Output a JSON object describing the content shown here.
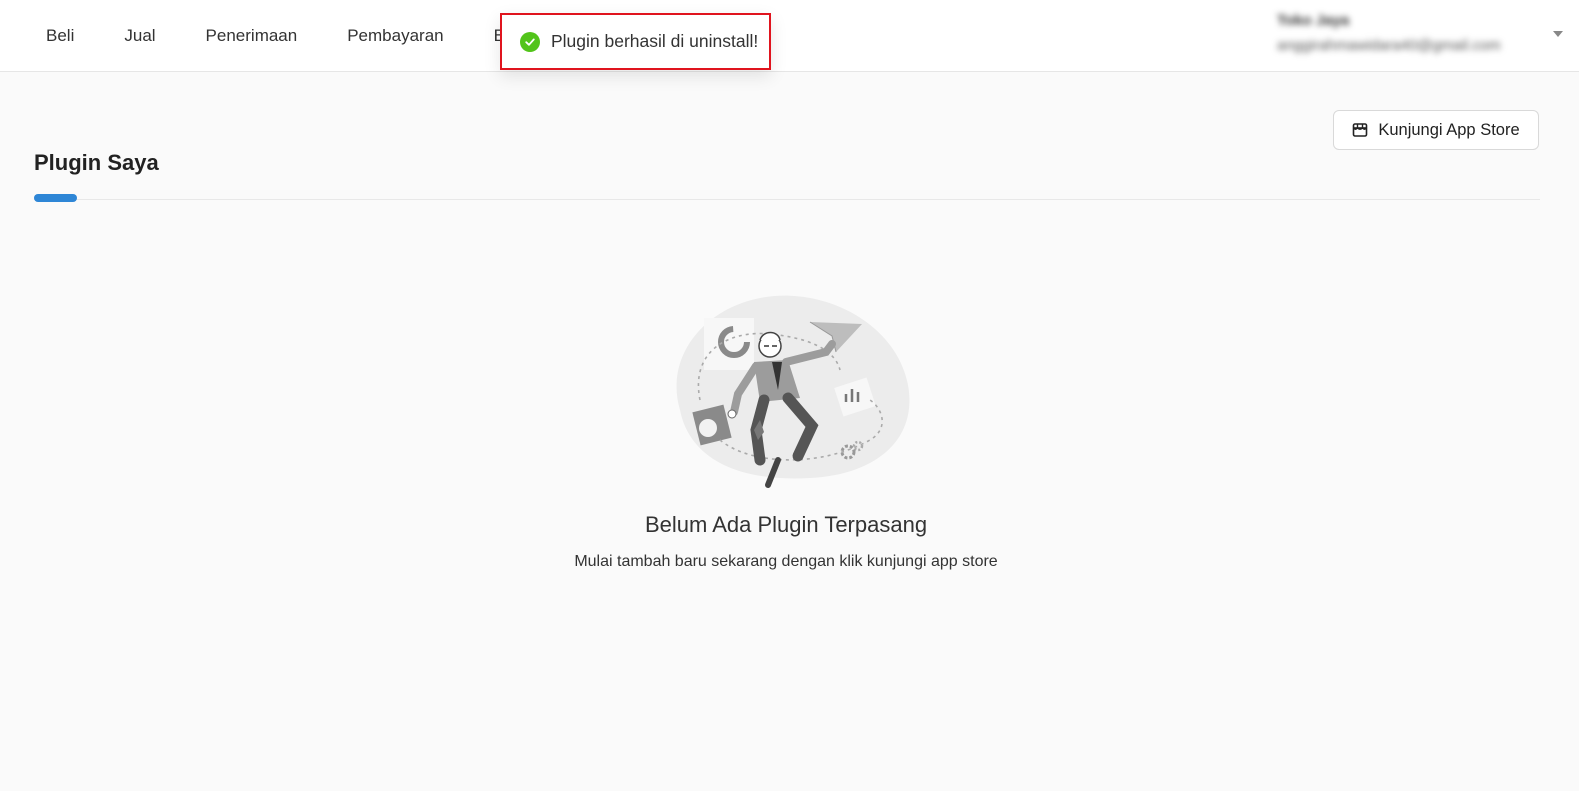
{
  "nav": {
    "items": [
      {
        "label": "Beli"
      },
      {
        "label": "Jual"
      },
      {
        "label": "Penerimaan"
      },
      {
        "label": "Pembayaran"
      },
      {
        "label": "Bia"
      }
    ]
  },
  "user": {
    "name": "Toko Jaya",
    "email": "anggirahmawidara40@gmail.com"
  },
  "toast": {
    "message": "Plugin berhasil di uninstall!",
    "status": "success",
    "icon": "check-circle-icon",
    "highlight_color": "#e0141e",
    "icon_color": "#52c41a"
  },
  "actions": {
    "store_button_label": "Kunjungi App Store",
    "store_button_icon": "store-icon"
  },
  "page": {
    "title": "Plugin Saya",
    "accent_color": "#2e86d6"
  },
  "empty_state": {
    "illustration": "person-jumping-illustration",
    "title": "Belum Ada Plugin Terpasang",
    "subtitle": "Mulai tambah baru sekarang dengan klik kunjungi app store"
  }
}
